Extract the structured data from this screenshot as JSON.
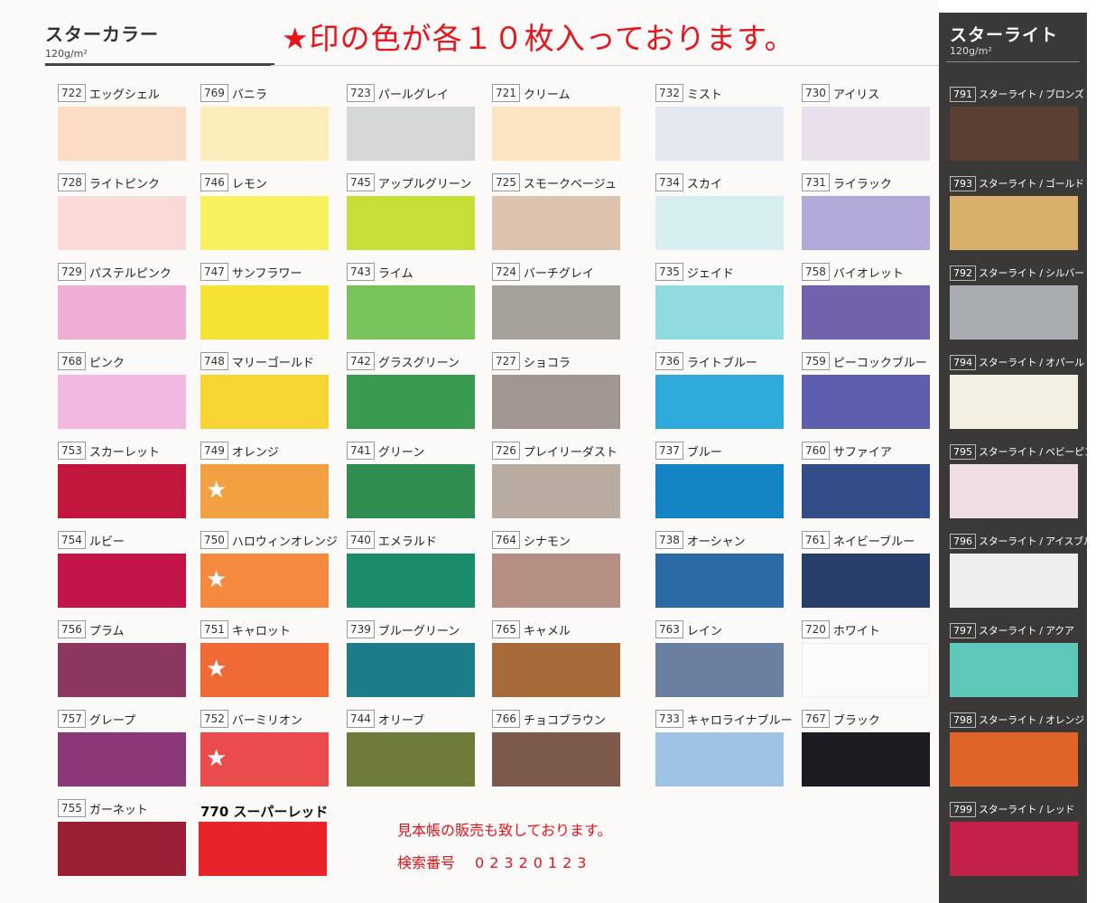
{
  "header": {
    "title": "スターカラー",
    "weight": "120g/m²",
    "notice": "★印の色が各１０枚入っております。"
  },
  "starlight": {
    "title": "スターライト",
    "weight": "120g/m²",
    "items": [
      {
        "code": "791",
        "name": "スターライト / ブロンズ",
        "color": "#5a3f32"
      },
      {
        "code": "793",
        "name": "スターライト / ゴールド",
        "color": "#d9b06a"
      },
      {
        "code": "792",
        "name": "スターライト / シルバー",
        "color": "#a9adb2"
      },
      {
        "code": "794",
        "name": "スターライト / オパール",
        "color": "#f3efe1"
      },
      {
        "code": "795",
        "name": "スターライト / ベビーピンク",
        "color": "#f0dde2"
      },
      {
        "code": "796",
        "name": "スターライト / アイスブルー",
        "color": "#eeefec"
      },
      {
        "code": "797",
        "name": "スターライト / アクア",
        "color": "#5ec9b8"
      },
      {
        "code": "798",
        "name": "スターライト / オレンジ",
        "color": "#de6428"
      },
      {
        "code": "799",
        "name": "スターライト / レッド",
        "color": "#c2214a"
      }
    ]
  },
  "columns": [
    [
      {
        "code": "722",
        "name": "エッグシェル",
        "color": "#fbdcc4",
        "star": false
      },
      {
        "code": "728",
        "name": "ライトピンク",
        "color": "#fadad9",
        "star": false
      },
      {
        "code": "729",
        "name": "パステルピンク",
        "color": "#efafd2",
        "star": false
      },
      {
        "code": "768",
        "name": "ピンク",
        "color": "#f2b8df",
        "star": false
      },
      {
        "code": "753",
        "name": "スカーレット",
        "color": "#c2173d",
        "star": false
      },
      {
        "code": "754",
        "name": "ルビー",
        "color": "#c31549",
        "star": false
      },
      {
        "code": "756",
        "name": "プラム",
        "color": "#8b3760",
        "star": false
      },
      {
        "code": "757",
        "name": "グレープ",
        "color": "#8a3677",
        "star": false
      },
      {
        "code": "755",
        "name": "ガーネット",
        "color": "#991d33",
        "star": false
      }
    ],
    [
      {
        "code": "769",
        "name": "バニラ",
        "color": "#fbeebb",
        "star": false
      },
      {
        "code": "746",
        "name": "レモン",
        "color": "#f7f160",
        "star": false
      },
      {
        "code": "747",
        "name": "サンフラワー",
        "color": "#f5e233",
        "star": false
      },
      {
        "code": "748",
        "name": "マリーゴールド",
        "color": "#f6d431",
        "star": false
      },
      {
        "code": "749",
        "name": "オレンジ",
        "color": "#f3a043",
        "star": true
      },
      {
        "code": "750",
        "name": "ハロウィンオレンジ",
        "color": "#f58a3e",
        "star": true
      },
      {
        "code": "751",
        "name": "キャロット",
        "color": "#f06a35",
        "star": true
      },
      {
        "code": "752",
        "name": "バーミリオン",
        "color": "#ea4c4d",
        "star": true
      }
    ],
    [
      {
        "code": "723",
        "name": "パールグレイ",
        "color": "#d6d8d8",
        "star": false
      },
      {
        "code": "745",
        "name": "アップルグリーン",
        "color": "#c8df3a",
        "star": false
      },
      {
        "code": "743",
        "name": "ライム",
        "color": "#7ac45c",
        "star": false
      },
      {
        "code": "742",
        "name": "グラスグリーン",
        "color": "#399b50",
        "star": false
      },
      {
        "code": "741",
        "name": "グリーン",
        "color": "#2f8f52",
        "star": false
      },
      {
        "code": "740",
        "name": "エメラルド",
        "color": "#1a8c6c",
        "star": false
      },
      {
        "code": "739",
        "name": "ブルーグリーン",
        "color": "#1d7c8a",
        "star": false
      },
      {
        "code": "744",
        "name": "オリーブ",
        "color": "#6f7b3a",
        "star": false
      }
    ],
    [
      {
        "code": "721",
        "name": "クリーム",
        "color": "#fde4c3",
        "star": false
      },
      {
        "code": "725",
        "name": "スモークベージュ",
        "color": "#dcc3ae",
        "star": false
      },
      {
        "code": "724",
        "name": "バーチグレイ",
        "color": "#a7a19c",
        "star": false
      },
      {
        "code": "727",
        "name": "ショコラ",
        "color": "#a29690",
        "star": false
      },
      {
        "code": "726",
        "name": "プレイリーダスト",
        "color": "#b8aca0",
        "star": false
      },
      {
        "code": "764",
        "name": "シナモン",
        "color": "#b58e84",
        "star": false
      },
      {
        "code": "765",
        "name": "キャメル",
        "color": "#a96a3a",
        "star": false
      },
      {
        "code": "766",
        "name": "チョコブラウン",
        "color": "#7c5a4b",
        "star": false
      }
    ],
    [
      {
        "code": "732",
        "name": "ミスト",
        "color": "#e3e7ef",
        "star": false
      },
      {
        "code": "734",
        "name": "スカイ",
        "color": "#d7eef0",
        "star": false
      },
      {
        "code": "735",
        "name": "ジェイド",
        "color": "#90dbe0",
        "star": false
      },
      {
        "code": "736",
        "name": "ライトブルー",
        "color": "#2faadb",
        "star": false
      },
      {
        "code": "737",
        "name": "ブルー",
        "color": "#1484c4",
        "star": false
      },
      {
        "code": "738",
        "name": "オーシャン",
        "color": "#2a6ba5",
        "star": false
      },
      {
        "code": "763",
        "name": "レイン",
        "color": "#6b7fa1",
        "star": false
      },
      {
        "code": "733",
        "name": "キャロライナブルー",
        "color": "#9fc3e5",
        "star": false
      }
    ],
    [
      {
        "code": "730",
        "name": "アイリス",
        "color": "#e9e0ec",
        "star": false
      },
      {
        "code": "731",
        "name": "ライラック",
        "color": "#b2a9d8",
        "star": false
      },
      {
        "code": "758",
        "name": "バイオレット",
        "color": "#7162ab",
        "star": false
      },
      {
        "code": "759",
        "name": "ピーコックブルー",
        "color": "#5e5eb0",
        "star": false
      },
      {
        "code": "760",
        "name": "サファイア",
        "color": "#344c8a",
        "star": false
      },
      {
        "code": "761",
        "name": "ネイビーブルー",
        "color": "#273f68",
        "star": false
      },
      {
        "code": "720",
        "name": "ホワイト",
        "color": "#fbfbfa",
        "star": false
      },
      {
        "code": "767",
        "name": "ブラック",
        "color": "#1c1b22",
        "star": false
      }
    ]
  ],
  "special": {
    "label": "770 スーパーレッド",
    "color": "#e8232a"
  },
  "footer": {
    "sales_note": "見本帳の販売も致しております。",
    "search_label": "検索番号",
    "search_number": "02320123"
  }
}
